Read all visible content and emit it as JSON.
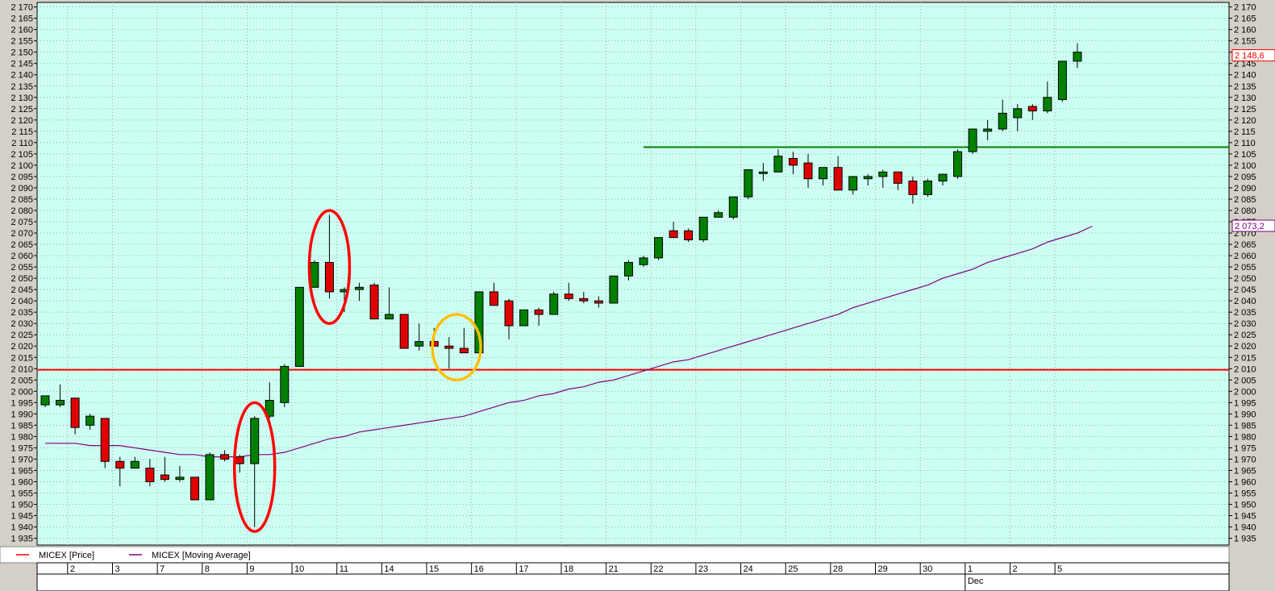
{
  "chart_data": {
    "type": "candlestick",
    "ylim": [
      1932,
      2172
    ],
    "y_ticks": [
      1935,
      1940,
      1945,
      1950,
      1955,
      1960,
      1965,
      1970,
      1975,
      1980,
      1985,
      1990,
      1995,
      2000,
      2005,
      2010,
      2015,
      2020,
      2025,
      2030,
      2035,
      2040,
      2045,
      2050,
      2055,
      2060,
      2065,
      2070,
      2075,
      2080,
      2085,
      2090,
      2095,
      2100,
      2105,
      2110,
      2115,
      2120,
      2125,
      2130,
      2135,
      2140,
      2145,
      2150,
      2155,
      2160,
      2165,
      2170
    ],
    "y_tick_labels": [
      "1 935",
      "1 940",
      "1 945",
      "1 950",
      "1 955",
      "1 960",
      "1 965",
      "1 970",
      "1 975",
      "1 980",
      "1 985",
      "1 990",
      "1 995",
      "2 000",
      "2 005",
      "2 010",
      "2 015",
      "2 020",
      "2 025",
      "2 030",
      "2 035",
      "2 040",
      "2 045",
      "2 050",
      "2 055",
      "2 060",
      "2 065",
      "2 070",
      "2 075",
      "2 080",
      "2 085",
      "2 090",
      "2 095",
      "2 100",
      "2 105",
      "2 110",
      "2 115",
      "2 120",
      "2 125",
      "2 130",
      "2 135",
      "2 140",
      "2 145",
      "2 150",
      "2 155",
      "2 160",
      "2 165",
      "2 170"
    ],
    "candles": [
      {
        "o": 1994,
        "h": 1998,
        "l": 1993,
        "c": 1998
      },
      {
        "o": 1994,
        "h": 2003,
        "l": 1993,
        "c": 1996
      },
      {
        "o": 1997,
        "h": 1997,
        "l": 1981,
        "c": 1984
      },
      {
        "o": 1985,
        "h": 1990,
        "l": 1983,
        "c": 1989
      },
      {
        "o": 1988,
        "h": 1988,
        "l": 1966,
        "c": 1969
      },
      {
        "o": 1969,
        "h": 1971,
        "l": 1958,
        "c": 1966
      },
      {
        "o": 1966,
        "h": 1971,
        "l": 1966,
        "c": 1969
      },
      {
        "o": 1966,
        "h": 1970,
        "l": 1958,
        "c": 1960
      },
      {
        "o": 1963,
        "h": 1971,
        "l": 1960,
        "c": 1961
      },
      {
        "o": 1961,
        "h": 1967,
        "l": 1960,
        "c": 1962
      },
      {
        "o": 1962,
        "h": 1962,
        "l": 1952,
        "c": 1952
      },
      {
        "o": 1952,
        "h": 1973,
        "l": 1952,
        "c": 1972
      },
      {
        "o": 1972,
        "h": 1974,
        "l": 1969,
        "c": 1970
      },
      {
        "o": 1971,
        "h": 1972,
        "l": 1964,
        "c": 1968
      },
      {
        "o": 1968,
        "h": 1989,
        "l": 1940,
        "c": 1988
      },
      {
        "o": 1989,
        "h": 2004,
        "l": 1988,
        "c": 1996
      },
      {
        "o": 1995,
        "h": 2012,
        "l": 1993,
        "c": 2011
      },
      {
        "o": 2011,
        "h": 2046,
        "l": 2011,
        "c": 2046
      },
      {
        "o": 2046,
        "h": 2058,
        "l": 2046,
        "c": 2057
      },
      {
        "o": 2057,
        "h": 2078,
        "l": 2041,
        "c": 2044
      },
      {
        "o": 2044,
        "h": 2046,
        "l": 2035,
        "c": 2045
      },
      {
        "o": 2045,
        "h": 2048,
        "l": 2040,
        "c": 2046
      },
      {
        "o": 2047,
        "h": 2048,
        "l": 2032,
        "c": 2032
      },
      {
        "o": 2032,
        "h": 2046,
        "l": 2032,
        "c": 2034
      },
      {
        "o": 2034,
        "h": 2034,
        "l": 2020,
        "c": 2019
      },
      {
        "o": 2020,
        "h": 2030,
        "l": 2018,
        "c": 2022
      },
      {
        "o": 2022,
        "h": 2028,
        "l": 2020,
        "c": 2020
      },
      {
        "o": 2020,
        "h": 2024,
        "l": 2010,
        "c": 2019
      },
      {
        "o": 2019,
        "h": 2028,
        "l": 2017,
        "c": 2017
      },
      {
        "o": 2017,
        "h": 2044,
        "l": 2017,
        "c": 2044
      },
      {
        "o": 2044,
        "h": 2048,
        "l": 2038,
        "c": 2038
      },
      {
        "o": 2040,
        "h": 2041,
        "l": 2023,
        "c": 2029
      },
      {
        "o": 2029,
        "h": 2036,
        "l": 2029,
        "c": 2036
      },
      {
        "o": 2036,
        "h": 2037,
        "l": 2029,
        "c": 2034
      },
      {
        "o": 2034,
        "h": 2044,
        "l": 2034,
        "c": 2043
      },
      {
        "o": 2043,
        "h": 2048,
        "l": 2040,
        "c": 2041
      },
      {
        "o": 2041,
        "h": 2044,
        "l": 2039,
        "c": 2040
      },
      {
        "o": 2040,
        "h": 2042,
        "l": 2037,
        "c": 2039
      },
      {
        "o": 2039,
        "h": 2051,
        "l": 2039,
        "c": 2051
      },
      {
        "o": 2051,
        "h": 2058,
        "l": 2049,
        "c": 2057
      },
      {
        "o": 2056,
        "h": 2060,
        "l": 2055,
        "c": 2059
      },
      {
        "o": 2059,
        "h": 2068,
        "l": 2058,
        "c": 2068
      },
      {
        "o": 2071,
        "h": 2075,
        "l": 2068,
        "c": 2068
      },
      {
        "o": 2071,
        "h": 2072,
        "l": 2066,
        "c": 2067
      },
      {
        "o": 2067,
        "h": 2077,
        "l": 2066,
        "c": 2077
      },
      {
        "o": 2077,
        "h": 2080,
        "l": 2077,
        "c": 2079
      },
      {
        "o": 2077,
        "h": 2086,
        "l": 2076,
        "c": 2086
      },
      {
        "o": 2086,
        "h": 2098,
        "l": 2085,
        "c": 2098
      },
      {
        "o": 2097,
        "h": 2101,
        "l": 2093,
        "c": 2097
      },
      {
        "o": 2097,
        "h": 2107,
        "l": 2097,
        "c": 2104
      },
      {
        "o": 2103,
        "h": 2106,
        "l": 2096,
        "c": 2100
      },
      {
        "o": 2101,
        "h": 2105,
        "l": 2090,
        "c": 2094
      },
      {
        "o": 2094,
        "h": 2099,
        "l": 2091,
        "c": 2099
      },
      {
        "o": 2099,
        "h": 2104,
        "l": 2089,
        "c": 2089
      },
      {
        "o": 2089,
        "h": 2095,
        "l": 2087,
        "c": 2095
      },
      {
        "o": 2094,
        "h": 2096,
        "l": 2091,
        "c": 2095
      },
      {
        "o": 2095,
        "h": 2098,
        "l": 2090,
        "c": 2097
      },
      {
        "o": 2097,
        "h": 2097,
        "l": 2089,
        "c": 2092
      },
      {
        "o": 2093,
        "h": 2095,
        "l": 2083,
        "c": 2087
      },
      {
        "o": 2087,
        "h": 2094,
        "l": 2086,
        "c": 2093
      },
      {
        "o": 2093,
        "h": 2096,
        "l": 2091,
        "c": 2096
      },
      {
        "o": 2095,
        "h": 2107,
        "l": 2094,
        "c": 2106
      },
      {
        "o": 2106,
        "h": 2116,
        "l": 2105,
        "c": 2116
      },
      {
        "o": 2115,
        "h": 2120,
        "l": 2111,
        "c": 2116
      },
      {
        "o": 2116,
        "h": 2129,
        "l": 2115,
        "c": 2123
      },
      {
        "o": 2121,
        "h": 2127,
        "l": 2115,
        "c": 2125
      },
      {
        "o": 2126,
        "h": 2127,
        "l": 2120,
        "c": 2124
      },
      {
        "o": 2124,
        "h": 2137,
        "l": 2123,
        "c": 2130
      },
      {
        "o": 2129,
        "h": 2146,
        "l": 2128,
        "c": 2146
      },
      {
        "o": 2146,
        "h": 2154,
        "l": 2143,
        "c": 2150
      }
    ],
    "moving_average": [
      1977,
      1977,
      1977,
      1976,
      1976,
      1976,
      1975,
      1974,
      1973,
      1972,
      1972,
      1971,
      1971,
      1971,
      1972,
      1972,
      1973,
      1975,
      1977,
      1979,
      1980,
      1982,
      1983,
      1984,
      1985,
      1986,
      1987,
      1988,
      1989,
      1991,
      1993,
      1995,
      1996,
      1998,
      1999,
      2001,
      2002,
      2004,
      2005,
      2007,
      2009,
      2011,
      2013,
      2014,
      2016,
      2018,
      2020,
      2022,
      2024,
      2026,
      2028,
      2030,
      2032,
      2034,
      2037,
      2039,
      2041,
      2043,
      2045,
      2047,
      2050,
      2052,
      2054,
      2057,
      2059,
      2061,
      2063,
      2066,
      2068,
      2070,
      2073
    ],
    "x_labels": [
      {
        "i": 2,
        "label": "2"
      },
      {
        "i": 5,
        "label": "3"
      },
      {
        "i": 8,
        "label": "7"
      },
      {
        "i": 11,
        "label": "8"
      },
      {
        "i": 14,
        "label": "9"
      },
      {
        "i": 17,
        "label": "10"
      },
      {
        "i": 20,
        "label": "11"
      },
      {
        "i": 23,
        "label": "14"
      },
      {
        "i": 26,
        "label": "15"
      },
      {
        "i": 29,
        "label": "16"
      },
      {
        "i": 32,
        "label": "17"
      },
      {
        "i": 35,
        "label": "18"
      },
      {
        "i": 38,
        "label": "21"
      },
      {
        "i": 41,
        "label": "22"
      },
      {
        "i": 44,
        "label": "23"
      },
      {
        "i": 47,
        "label": "24"
      },
      {
        "i": 50,
        "label": "25"
      },
      {
        "i": 53,
        "label": "28"
      },
      {
        "i": 56,
        "label": "29"
      },
      {
        "i": 59,
        "label": "30"
      },
      {
        "i": 62,
        "label": "1"
      },
      {
        "i": 65,
        "label": "2"
      },
      {
        "i": 68,
        "label": "5"
      }
    ],
    "month_label": {
      "i": 62,
      "label": "Dec"
    },
    "hlines": [
      {
        "value": 2009.5,
        "color": "#ff0000",
        "from_i": 0
      },
      {
        "value": 2108,
        "color": "#008000",
        "from_i": 40
      }
    ],
    "price_label": {
      "value": 2148.6,
      "text": "2 148,6",
      "color": "#ff0000"
    },
    "ma_label": {
      "value": 2073.2,
      "text": "2 073,2",
      "color": "#800080"
    },
    "annotations": [
      {
        "type": "ellipse",
        "i": 14,
        "y1": 1938,
        "y2": 1995,
        "color": "#ff0000"
      },
      {
        "type": "ellipse",
        "i": 19,
        "y1": 2030,
        "y2": 2080,
        "color": "#ff0000"
      },
      {
        "type": "ellipse",
        "i": 27.5,
        "y1": 2005,
        "y2": 2034,
        "color": "#ffc000"
      }
    ],
    "legend": [
      {
        "name": "MICEX [Price]",
        "color": "#ff0000"
      },
      {
        "name": "MICEX [Moving Average]",
        "color": "#800080"
      }
    ],
    "colors": {
      "background": "#ccfff2",
      "up": "#008000",
      "down": "#e00000",
      "grid": "#9ab",
      "ma": "#800080"
    }
  }
}
